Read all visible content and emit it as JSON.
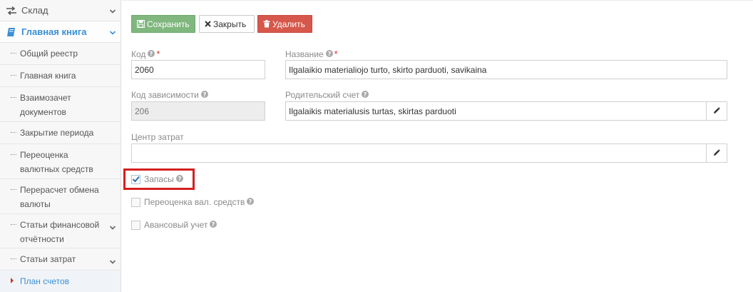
{
  "sidebar": {
    "sklad": {
      "label": "Склад",
      "icon": "exchange-arrows-icon"
    },
    "general_ledger": {
      "label": "Главная книга",
      "icon": "book-icon"
    },
    "items": [
      {
        "label": "Общий реестр"
      },
      {
        "label": "Главная книга"
      },
      {
        "label": "Взаимозачет документов"
      },
      {
        "label": "Закрытие периода"
      },
      {
        "label": "Переоценка валютных средств"
      },
      {
        "label": "Перерасчет обмена валюты"
      },
      {
        "label": "Статьи финансовой отчётности"
      },
      {
        "label": "Статьи затрат"
      },
      {
        "label": "План счетов"
      }
    ]
  },
  "toolbar": {
    "save_label": "Сохранить",
    "close_label": "Закрыть",
    "delete_label": "Удалить"
  },
  "form": {
    "code": {
      "label": "Код",
      "value": "2060"
    },
    "name": {
      "label": "Название",
      "value": "Ilgalaikio materialiojo turto, skirto parduoti, savikaina"
    },
    "dependency_code": {
      "label": "Код зависимости",
      "value": "206"
    },
    "parent_account": {
      "label": "Родительский счет",
      "value": "Ilgalaikis materialusis turtas, skirtas parduoti"
    },
    "cost_center": {
      "label": "Центр затрат",
      "value": ""
    },
    "checkboxes": {
      "stock": {
        "label": "Запасы",
        "checked": true
      },
      "revaluation": {
        "label": "Переоценка вал. средств",
        "checked": false
      },
      "advance": {
        "label": "Авансовый учет",
        "checked": false
      }
    }
  },
  "colors": {
    "accent": "#3b8fd6",
    "save": "#7fb77e",
    "delete": "#d6574b",
    "highlight": "#d42020"
  }
}
